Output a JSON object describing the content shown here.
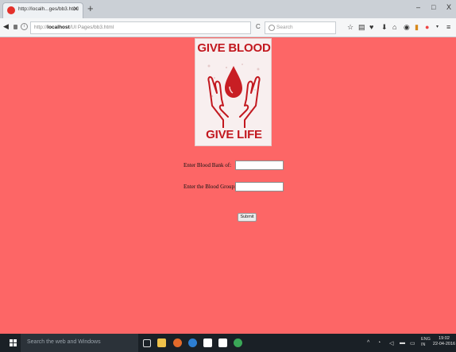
{
  "browser": {
    "tab_title": "http://localh...ges/bb3.html",
    "tab_close": "✕",
    "new_tab": "+",
    "url_prefix": "http://",
    "url_host": "localhost",
    "url_path": "/UI Pages/bb3.html",
    "search_placeholder": "Search",
    "reload_icon": "C",
    "window_minimize": "–",
    "window_maximize": "□",
    "window_close": "X"
  },
  "logo": {
    "line1": "GIVE BLOOD",
    "line2": "GIVE LIFE",
    "colors": {
      "text": "#c2181f",
      "drop": "#c81e24",
      "hands": "#c2181f"
    }
  },
  "form": {
    "bank_label": "Enter Blood Bank of:",
    "bank_value": "",
    "group_label": "Enter the Blood Group:",
    "group_value": "",
    "submit_label": "Submit"
  },
  "taskbar": {
    "search_placeholder": "Search the web and Windows",
    "language": "ENG",
    "region": "IN",
    "time": "19:02",
    "date": "22-04-2016",
    "icons": [
      "task-view-icon",
      "file-explorer-icon",
      "firefox-icon",
      "edge-icon",
      "store-icon",
      "amazon-icon",
      "chrome-icon"
    ]
  },
  "colors": {
    "page_background": "#fd6666",
    "taskbar": "#1a2026",
    "tabstrip": "#cbd0d6"
  }
}
